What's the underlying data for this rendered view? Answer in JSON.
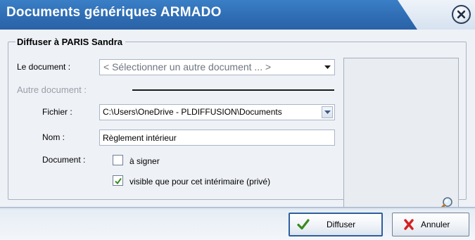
{
  "window": {
    "title": "Documents génériques ARMADO"
  },
  "group": {
    "title": "Diffuser à PARIS Sandra"
  },
  "document_row": {
    "label": "Le document :",
    "selected_value": "< Sélectionner un autre document ... >"
  },
  "other_document": {
    "section_label": "Autre document :",
    "file_label": "Fichier :",
    "file_value": "C:\\Users\\OneDrive - PLDIFFUSION\\Documents",
    "name_label": "Nom :",
    "name_value": "Règlement intérieur",
    "document_label": "Document :",
    "checkbox_sign": {
      "label": "à signer",
      "checked": false
    },
    "checkbox_private": {
      "label": "visible que pour cet intérimaire (privé)",
      "checked": true
    }
  },
  "footer": {
    "diffuse_label": "Diffuser",
    "cancel_label": "Annuler"
  },
  "icons": {
    "close": "close-icon",
    "check": "checkmark-icon",
    "cross": "red-x-icon",
    "zoom": "magnifier-icon"
  },
  "colors": {
    "title_bar": "#2f6db4",
    "check_green": "#3a8a1e",
    "cancel_red": "#d42020"
  }
}
